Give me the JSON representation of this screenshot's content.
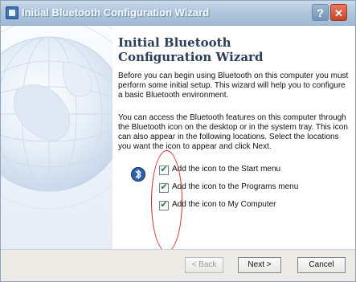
{
  "window": {
    "title": "Initial Bluetooth Configuration Wizard"
  },
  "content": {
    "heading": "Initial Bluetooth Configuration Wizard",
    "paragraph1": "Before you can begin using Bluetooth on this computer you must perform some initial setup. This wizard will help you to configure a basic Bluetooth environment.",
    "paragraph2": "You can access the Bluetooth features on this computer through the Bluetooth icon on the desktop or in the system tray. This icon can also appear in the following locations. Select the locations you want the icon to appear and click Next.",
    "checkboxes": [
      {
        "label": "Add the icon to the Start menu",
        "checked": true
      },
      {
        "label": "Add the icon to the Programs menu",
        "checked": true
      },
      {
        "label": "Add the icon to My Computer",
        "checked": true
      }
    ]
  },
  "buttons": {
    "back": "< Back",
    "next": "Next >",
    "cancel": "Cancel"
  },
  "icons": {
    "title": "wizard-icon",
    "help": "help-icon",
    "close": "close-icon",
    "bluetooth": "bluetooth-icon",
    "check": "checkmark-icon"
  },
  "colors": {
    "accent": "#3f73b1",
    "annotation": "#d22c2c"
  }
}
